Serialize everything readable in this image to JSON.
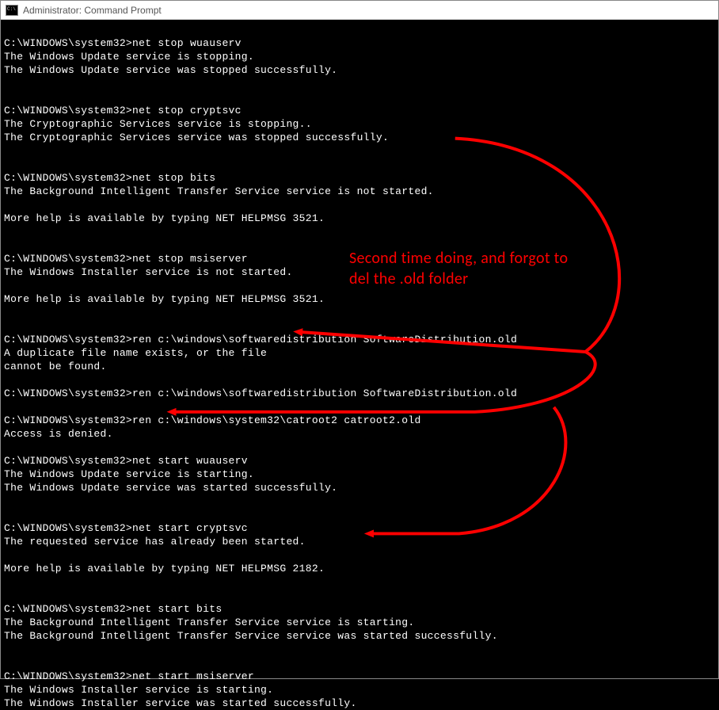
{
  "window": {
    "title": "Administrator: Command Prompt"
  },
  "prompt_prefix": "C:\\WINDOWS\\system32>",
  "terminal": {
    "blocks": [
      {
        "cmd": "net stop wuauserv",
        "out": [
          "The Windows Update service is stopping.",
          "The Windows Update service was stopped successfully."
        ],
        "blank_after": 2
      },
      {
        "cmd": "net stop cryptsvc",
        "out": [
          "The Cryptographic Services service is stopping..",
          "The Cryptographic Services service was stopped successfully."
        ],
        "blank_after": 2
      },
      {
        "cmd": "net stop bits",
        "out": [
          "The Background Intelligent Transfer Service service is not started.",
          "",
          "More help is available by typing NET HELPMSG 3521."
        ],
        "blank_after": 2
      },
      {
        "cmd": "net stop msiserver",
        "out": [
          "The Windows Installer service is not started.",
          "",
          "More help is available by typing NET HELPMSG 3521."
        ],
        "blank_after": 2
      },
      {
        "cmd": "ren c:\\windows\\softwaredistribution SoftwareDistribution.old",
        "out": [
          "A duplicate file name exists, or the file",
          "cannot be found."
        ],
        "blank_after": 1
      },
      {
        "cmd": "ren c:\\windows\\softwaredistribution SoftwareDistribution.old",
        "out": [],
        "blank_after": 1
      },
      {
        "cmd": "ren c:\\windows\\system32\\catroot2 catroot2.old",
        "out": [
          "Access is denied."
        ],
        "blank_after": 1
      },
      {
        "cmd": "net start wuauserv",
        "out": [
          "The Windows Update service is starting.",
          "The Windows Update service was started successfully."
        ],
        "blank_after": 2
      },
      {
        "cmd": "net start cryptsvc",
        "out": [
          "The requested service has already been started.",
          "",
          "More help is available by typing NET HELPMSG 2182."
        ],
        "blank_after": 2
      },
      {
        "cmd": "net start bits",
        "out": [
          "The Background Intelligent Transfer Service service is starting.",
          "The Background Intelligent Transfer Service service was started successfully."
        ],
        "blank_after": 2
      },
      {
        "cmd": "net start msiserver",
        "out": [
          "The Windows Installer service is starting.",
          "The Windows Installer service was started successfully."
        ],
        "blank_after": 0
      }
    ]
  },
  "annotation": {
    "text": "Second time doing, and forgot to del the .old folder",
    "color": "#ff0000"
  }
}
